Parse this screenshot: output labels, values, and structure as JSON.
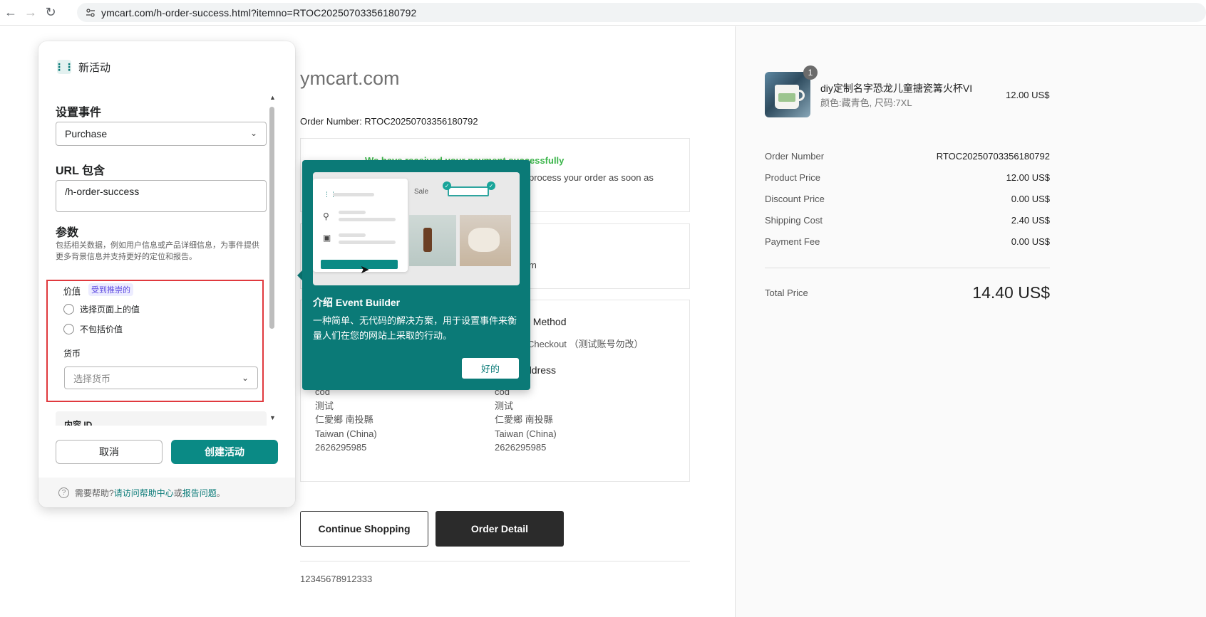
{
  "browser": {
    "back_icon": "back-arrow-icon",
    "forward_icon": "forward-arrow-icon",
    "reload_icon": "reload-icon",
    "site_info_icon": "site-info-icon",
    "url": "ymcart.com/h-order-success.html?itemno=RTOC20250703356180792"
  },
  "page": {
    "site_name": "ymcart.com",
    "order_number_line": "Order Number: RTOC20250703356180792",
    "success_message": "We have received your payment successfully",
    "process_message": "process your order as soon as",
    "box2_partial": "m",
    "payment_method_title": "t Method",
    "payment_method_value": "Checkout （测试账号勿改）",
    "address_title": "ddress",
    "billing_address": [
      "cod",
      "测试",
      "仁愛鄉 南投縣",
      "Taiwan (China)",
      "2626295985"
    ],
    "shipping_address": [
      "cod",
      "测试",
      "仁愛鄉 南投縣",
      "Taiwan (China)",
      "2626295985"
    ],
    "continue_shopping_label": "Continue Shopping",
    "order_detail_label": "Order Detail",
    "footer_number": "12345678912333"
  },
  "summary": {
    "product": {
      "quantity": "1",
      "name": "diy定制名字恐龙儿童搪瓷篝火杯VI",
      "variant": "颜色:藏青色, 尺码:7XL",
      "price": "12.00 US$"
    },
    "rows": [
      {
        "label": "Order Number",
        "value": "RTOC20250703356180792"
      },
      {
        "label": "Product Price",
        "value": "12.00 US$"
      },
      {
        "label": "Discount Price",
        "value": "0.00 US$"
      },
      {
        "label": "Shipping Cost",
        "value": "2.40 US$"
      },
      {
        "label": "Payment Fee",
        "value": "0.00 US$"
      }
    ],
    "total_label": "Total Price",
    "total_value": "14.40 US$"
  },
  "event_builder": {
    "title": "新活动",
    "set_event_label": "设置事件",
    "event_value": "Purchase",
    "url_contains_label": "URL 包含",
    "url_contains_value": "/h-order-success",
    "params_label": "参数",
    "params_description": "包括相关数据，例如用户信息或产品详细信息，为事件提供更多背景信息并支持更好的定位和报告。",
    "value_label": "价值",
    "recommended_badge": "受到推崇的",
    "radio_select_on_page": "选择页面上的值",
    "radio_exclude_value": "不包括价值",
    "currency_label": "货币",
    "currency_placeholder": "选择货币",
    "content_id_label": "内容 ID",
    "cancel_label": "取消",
    "create_label": "创建活动",
    "help_prefix": "需要帮助?",
    "help_link1": "请访问帮助中心",
    "help_or": "或",
    "help_link2": "报告问题",
    "help_suffix": "。"
  },
  "popover": {
    "illustration_sale": "Sale",
    "title": "介绍 Event Builder",
    "body": "一种简单、无代码的解决方案，用于设置事件来衡量人们在您的网站上采取的行动。",
    "ok_label": "好的"
  }
}
